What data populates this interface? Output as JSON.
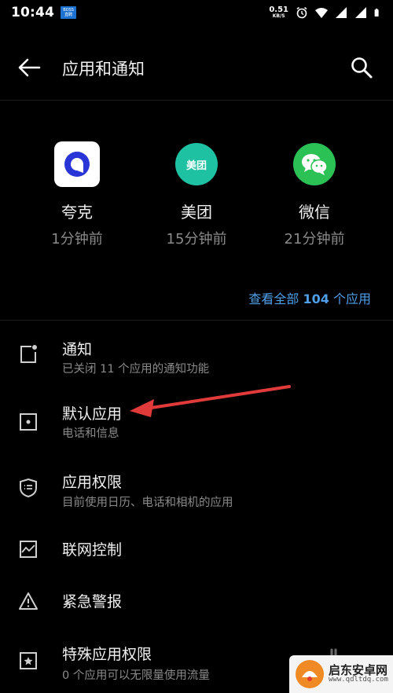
{
  "status_bar": {
    "time": "10:44",
    "badge_line1": "BOSS",
    "badge_line2": "直聘",
    "net_speed_value": "0.51",
    "net_speed_unit": "KB/S",
    "icons": [
      "alarm-icon",
      "wifi-icon",
      "signal-icon",
      "signal-icon",
      "battery-icon"
    ]
  },
  "app_bar": {
    "title": "应用和通知",
    "back_icon": "arrow-left-icon",
    "search_icon": "search-icon"
  },
  "recent_apps": [
    {
      "name": "夸克",
      "time": "1分钟前",
      "icon": "quark-app-icon",
      "color": "#ffffff"
    },
    {
      "name": "美团",
      "time": "15分钟前",
      "icon": "meituan-app-icon",
      "icon_text": "美团",
      "color": "#1fc1a3"
    },
    {
      "name": "微信",
      "time": "21分钟前",
      "icon": "wechat-app-icon",
      "color": "#2bc155"
    }
  ],
  "see_all": {
    "prefix": "查看全部",
    "count": "104",
    "suffix": "个应用"
  },
  "settings": [
    {
      "title": "通知",
      "subtitle": "已关闭 11 个应用的通知功能",
      "icon": "notification-icon"
    },
    {
      "title": "默认应用",
      "subtitle": "电话和信息",
      "icon": "default-apps-icon"
    },
    {
      "title": "应用权限",
      "subtitle": "目前使用日历、电话和相机的应用",
      "icon": "shield-list-icon"
    },
    {
      "title": "联网控制",
      "subtitle": "",
      "icon": "data-usage-chart-icon"
    },
    {
      "title": "紧急警报",
      "subtitle": "",
      "icon": "warning-triangle-icon"
    },
    {
      "title": "特殊应用权限",
      "subtitle": "0 个应用可以无限量使用流量",
      "icon": "star-square-icon"
    }
  ],
  "watermark": {
    "name": "启东安卓网",
    "url": "www.qdltdq.com"
  },
  "colors": {
    "background": "#000000",
    "accent": "#4f9fea",
    "annotation_arrow": "#e03a3a"
  }
}
